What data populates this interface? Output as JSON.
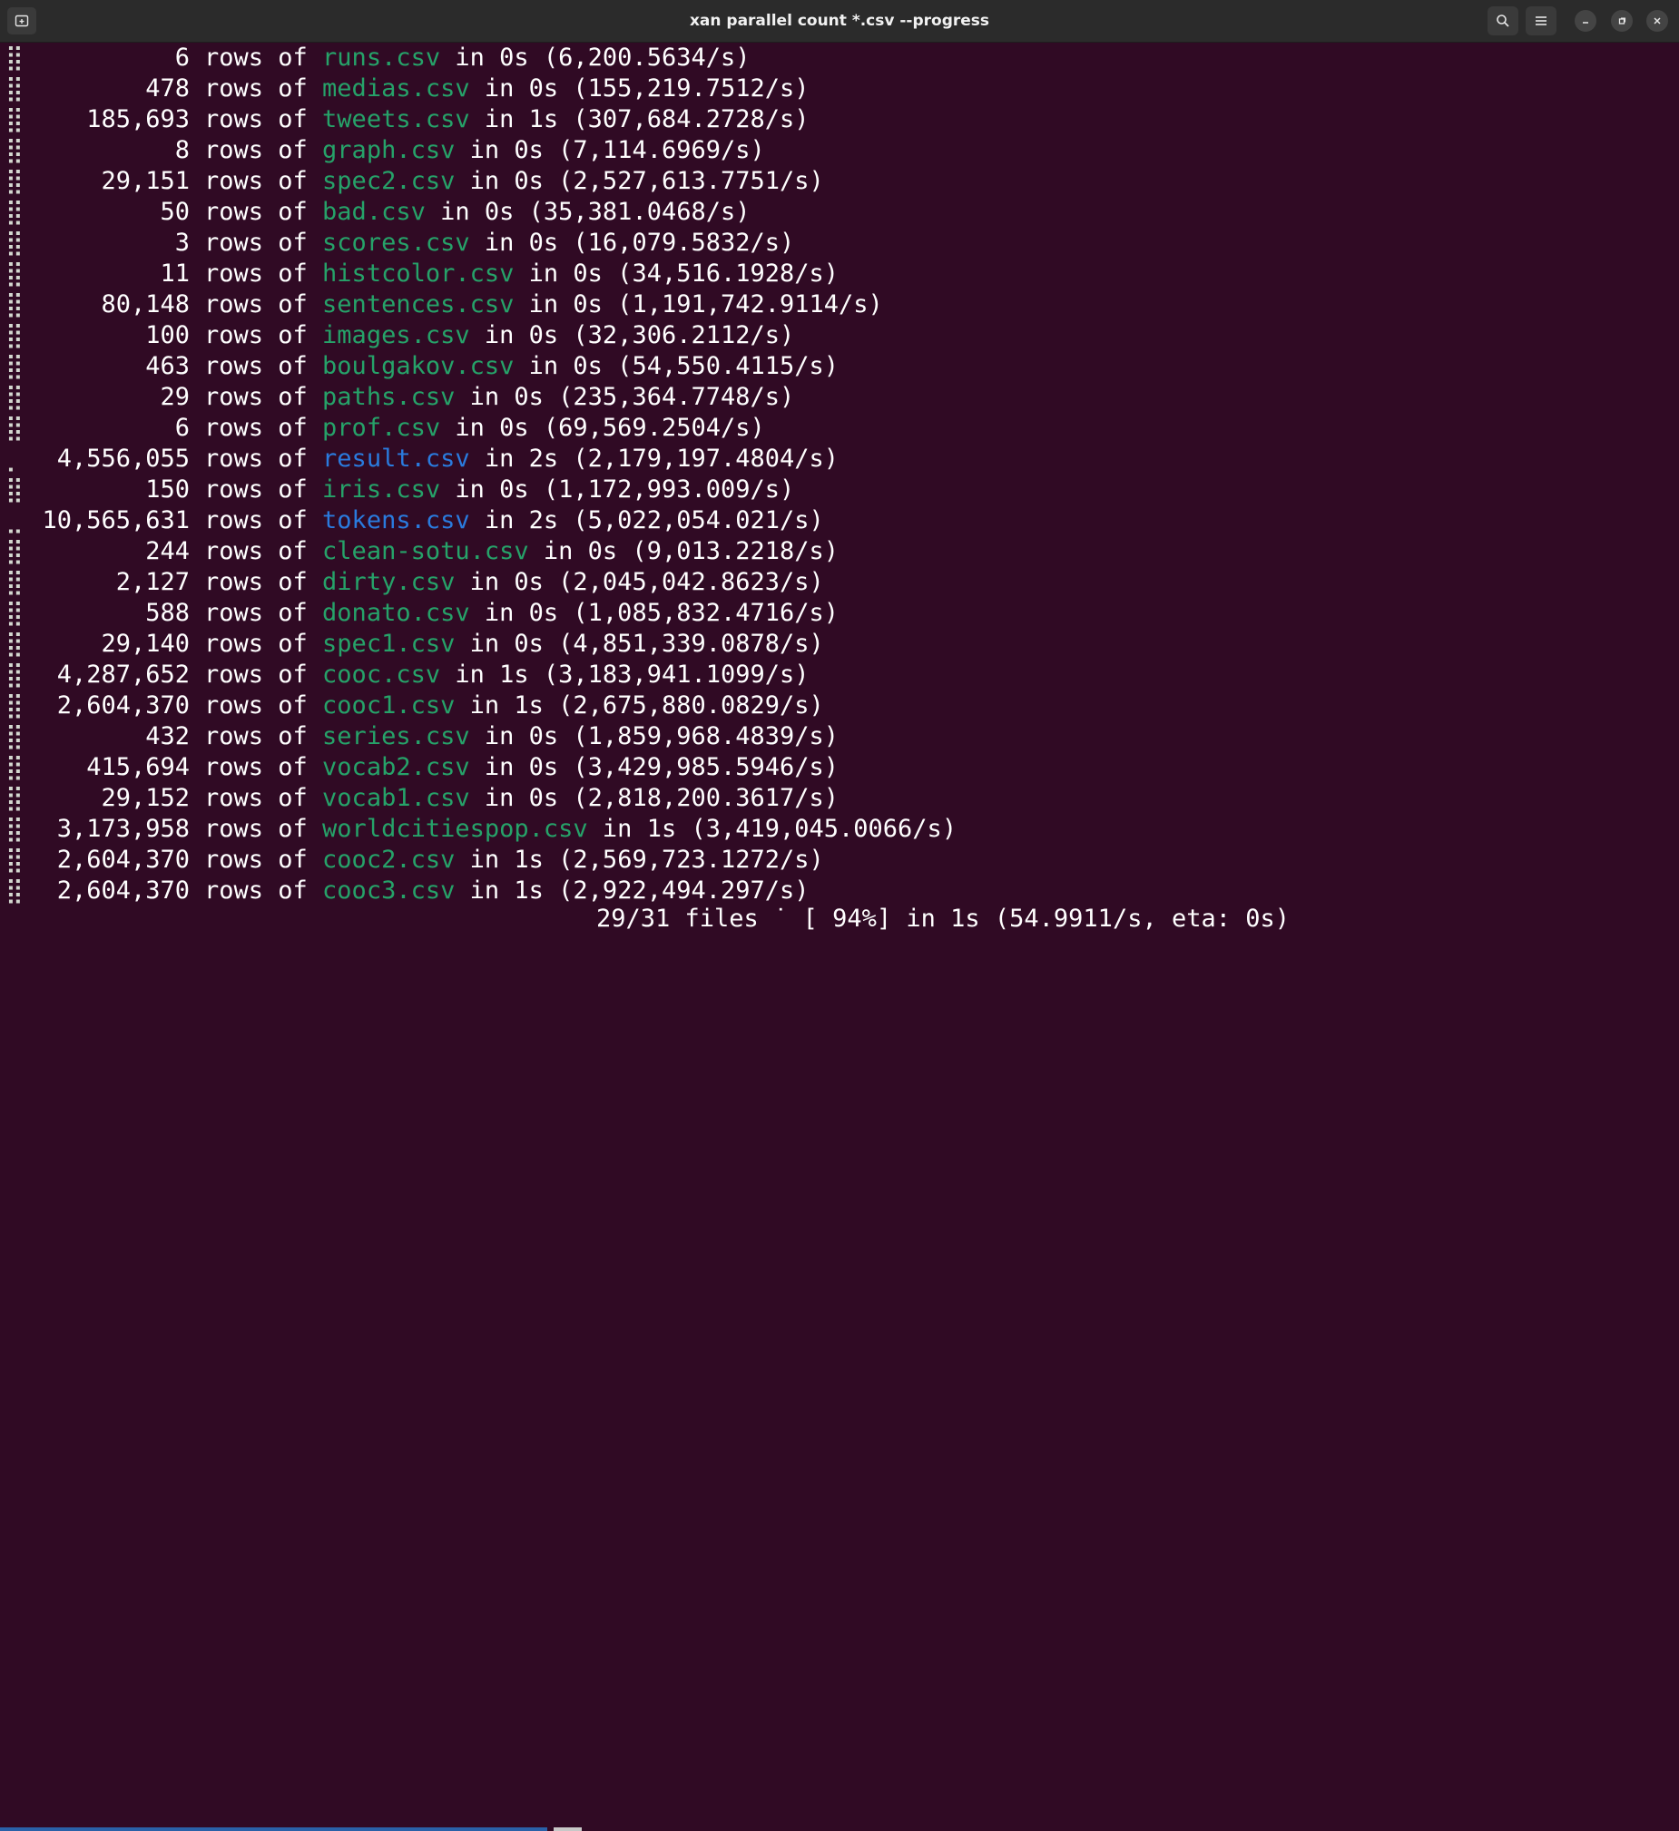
{
  "window": {
    "title": "xan parallel count *.csv --progress"
  },
  "icons": {
    "new_tab": "new-tab-icon",
    "search": "search-icon",
    "menu": "hamburger-menu-icon",
    "minimize": "minimize-icon",
    "maximize": "maximize-icon",
    "close": "close-icon"
  },
  "colors": {
    "background": "#300a24",
    "titlebar": "#2b2b2b",
    "filename_green": "#26a269",
    "filename_blue": "#2a7bde",
    "progress_done": "#2a61a8",
    "progress_remaining": "#c8c8c8"
  },
  "lines": [
    {
      "spinner": "⣿",
      "count": "6",
      "file": "runs.csv",
      "time": "0s",
      "rate": "6,200.5634/s",
      "color": "green"
    },
    {
      "spinner": "⣿",
      "count": "478",
      "file": "medias.csv",
      "time": "0s",
      "rate": "155,219.7512/s",
      "color": "green"
    },
    {
      "spinner": "⣿",
      "count": "185,693",
      "file": "tweets.csv",
      "time": "1s",
      "rate": "307,684.2728/s",
      "color": "green"
    },
    {
      "spinner": "⣿",
      "count": "8",
      "file": "graph.csv",
      "time": "0s",
      "rate": "7,114.6969/s",
      "color": "green"
    },
    {
      "spinner": "⣿",
      "count": "29,151",
      "file": "spec2.csv",
      "time": "0s",
      "rate": "2,527,613.7751/s",
      "color": "green"
    },
    {
      "spinner": "⣿",
      "count": "50",
      "file": "bad.csv",
      "time": "0s",
      "rate": "35,381.0468/s",
      "color": "green"
    },
    {
      "spinner": "⣿",
      "count": "3",
      "file": "scores.csv",
      "time": "0s",
      "rate": "16,079.5832/s",
      "color": "green"
    },
    {
      "spinner": "⣿",
      "count": "11",
      "file": "histcolor.csv",
      "time": "0s",
      "rate": "34,516.1928/s",
      "color": "green"
    },
    {
      "spinner": "⣿",
      "count": "80,148",
      "file": "sentences.csv",
      "time": "0s",
      "rate": "1,191,742.9114/s",
      "color": "green"
    },
    {
      "spinner": "⣿",
      "count": "100",
      "file": "images.csv",
      "time": "0s",
      "rate": "32,306.2112/s",
      "color": "green"
    },
    {
      "spinner": "⣿",
      "count": "463",
      "file": "boulgakov.csv",
      "time": "0s",
      "rate": "54,550.4115/s",
      "color": "green"
    },
    {
      "spinner": "⣿",
      "count": "29",
      "file": "paths.csv",
      "time": "0s",
      "rate": "235,364.7748/s",
      "color": "green"
    },
    {
      "spinner": "⣿",
      "count": "6",
      "file": "prof.csv",
      "time": "0s",
      "rate": "69,569.2504/s",
      "color": "green"
    },
    {
      "spinner": "⡀",
      "count": "4,556,055",
      "file": "result.csv",
      "time": "2s",
      "rate": "2,179,197.4804/s",
      "color": "blue"
    },
    {
      "spinner": "⣿",
      "count": "150",
      "file": "iris.csv",
      "time": "0s",
      "rate": "1,172,993.009/s",
      "color": "green"
    },
    {
      "spinner": "⣀",
      "count": "10,565,631",
      "file": "tokens.csv",
      "time": "2s",
      "rate": "5,022,054.021/s",
      "color": "blue"
    },
    {
      "spinner": "⣿",
      "count": "244",
      "file": "clean-sotu.csv",
      "time": "0s",
      "rate": "9,013.2218/s",
      "color": "green"
    },
    {
      "spinner": "⣿",
      "count": "2,127",
      "file": "dirty.csv",
      "time": "0s",
      "rate": "2,045,042.8623/s",
      "color": "green"
    },
    {
      "spinner": "⣿",
      "count": "588",
      "file": "donato.csv",
      "time": "0s",
      "rate": "1,085,832.4716/s",
      "color": "green"
    },
    {
      "spinner": "⣿",
      "count": "29,140",
      "file": "spec1.csv",
      "time": "0s",
      "rate": "4,851,339.0878/s",
      "color": "green"
    },
    {
      "spinner": "⣿",
      "count": "4,287,652",
      "file": "cooc.csv",
      "time": "1s",
      "rate": "3,183,941.1099/s",
      "color": "green"
    },
    {
      "spinner": "⣿",
      "count": "2,604,370",
      "file": "cooc1.csv",
      "time": "1s",
      "rate": "2,675,880.0829/s",
      "color": "green"
    },
    {
      "spinner": "⣿",
      "count": "432",
      "file": "series.csv",
      "time": "0s",
      "rate": "1,859,968.4839/s",
      "color": "green"
    },
    {
      "spinner": "⣿",
      "count": "415,694",
      "file": "vocab2.csv",
      "time": "0s",
      "rate": "3,429,985.5946/s",
      "color": "green"
    },
    {
      "spinner": "⣿",
      "count": "29,152",
      "file": "vocab1.csv",
      "time": "0s",
      "rate": "2,818,200.3617/s",
      "color": "green"
    },
    {
      "spinner": "⣿",
      "count": "3,173,958",
      "file": "worldcitiespop.csv",
      "time": "1s",
      "rate": "3,419,045.0066/s",
      "color": "green"
    },
    {
      "spinner": "⣿",
      "count": "2,604,370",
      "file": "cooc2.csv",
      "time": "1s",
      "rate": "2,569,723.1272/s",
      "color": "green"
    },
    {
      "spinner": "⣿",
      "count": "2,604,370",
      "file": "cooc3.csv",
      "time": "1s",
      "rate": "2,922,494.297/s",
      "color": "green"
    }
  ],
  "progress": {
    "fraction": 0.94,
    "text": "29/31 files ˙ [ 94%] in 1s (54.9911/s, eta: 0s)"
  }
}
